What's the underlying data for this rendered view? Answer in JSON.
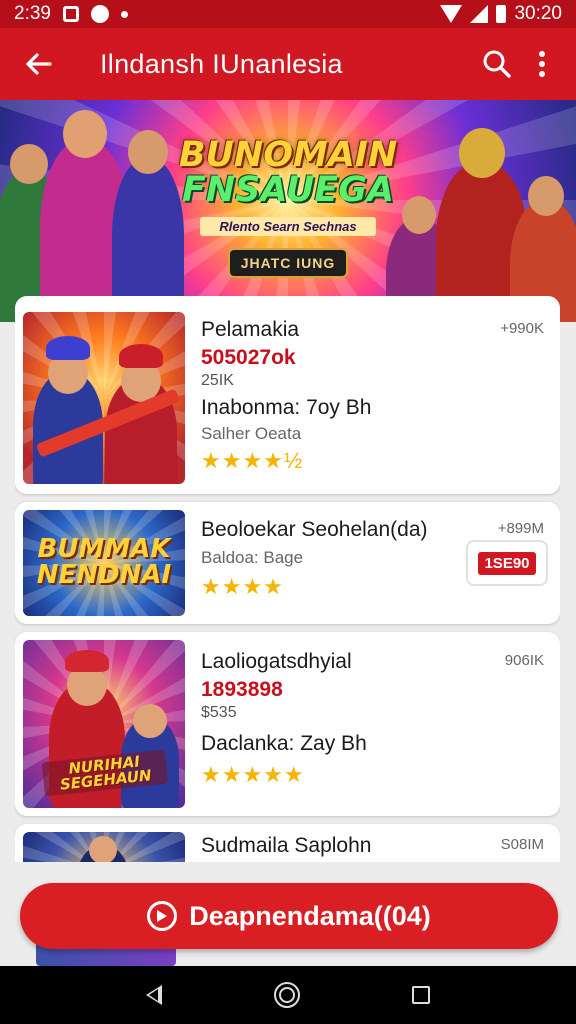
{
  "status": {
    "time": "2:39",
    "clock": "30:20"
  },
  "appbar": {
    "title": "Ilndansh IUnanlesia",
    "back_icon": "arrow-left-icon",
    "search_icon": "search-icon",
    "more_icon": "more-vert-icon"
  },
  "banner": {
    "title_line1": "BUNOMAIN",
    "title_line2": "FNSAUEGA",
    "subtitle": "Rlento Searn Sechnas",
    "button": "JHATC IUNG"
  },
  "cards": [
    {
      "name": "Pelamakia",
      "size": "+990K",
      "price": "505027ok",
      "small": "25IK",
      "subtitle": "Inabonma: 7oy Bh",
      "developer": "Salher Oeata",
      "stars": "★★★★½"
    },
    {
      "name": "Beoloekar Seohelan(da)",
      "size": "+899M",
      "developer": "Baldoa: Bage",
      "stars": "★★★★",
      "badge": "1SE90",
      "thumb_title1": "BUMMAK",
      "thumb_title2": "NENDNAI"
    },
    {
      "name": "Laoliogatsdhyial",
      "size": "906IK",
      "price": "1893898",
      "small": "$535",
      "subtitle": "Daclanka: Zay Bh",
      "stars": "★★★★★",
      "thumb_label": "NURIHAI SEGEHAUN"
    },
    {
      "name": "Sudmaila Saplohn",
      "size": "S08IM"
    }
  ],
  "action": {
    "label": "Deapnendama((04)",
    "icon": "play-circle-icon"
  },
  "nav": {
    "back_icon": "nav-back-icon",
    "home_icon": "nav-home-icon",
    "recent_icon": "nav-recent-icon"
  }
}
